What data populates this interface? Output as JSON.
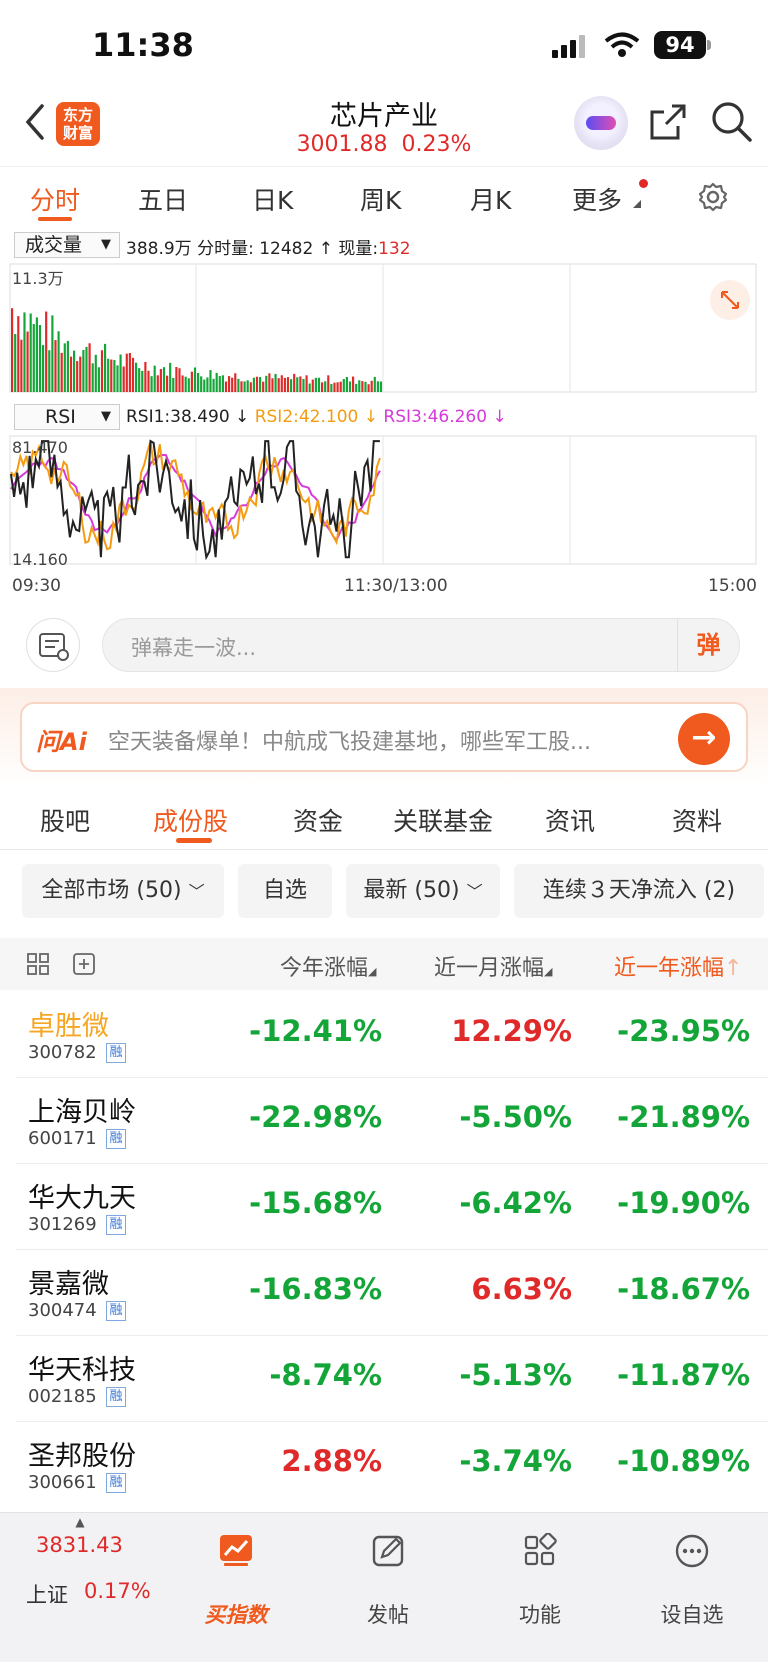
{
  "status_bar": {
    "time": "11:38",
    "battery": "94"
  },
  "header": {
    "brand": "东方\n财富",
    "title": "芯片产业",
    "price": "3001.88",
    "change": "0.23%"
  },
  "tabs": [
    "分时",
    "五日",
    "日K",
    "周K",
    "月K",
    "更多"
  ],
  "volume_panel": {
    "selector": "成交量",
    "total": "388.9万",
    "fenshi_label": "分时量:",
    "fenshi_value": "12482",
    "xianliang_label": "现量:",
    "xianliang_value": "132",
    "ymax": "11.3万"
  },
  "rsi_panel": {
    "selector": "RSI",
    "rsi1": "RSI1:38.490 ↓",
    "rsi2": "RSI2:42.100 ↓",
    "rsi3": "RSI3:46.260 ↓",
    "ymax": "81.470",
    "ymin": "14.160",
    "colors": {
      "rsi1": "#222222",
      "rsi2": "#f39c12",
      "rsi3": "#d63adb"
    }
  },
  "time_axis": {
    "start": "09:30",
    "mid": "11:30/13:00",
    "end": "15:00"
  },
  "danmu": {
    "placeholder": "弹幕走一波...",
    "button": "弹"
  },
  "ai": {
    "logo": "问Ai",
    "text": "空天装备爆单！中航成飞投建基地，哪些军工股..."
  },
  "subtabs": [
    "股吧",
    "成份股",
    "资金",
    "关联基金",
    "资讯",
    "资料"
  ],
  "filters": [
    "全部市场 (50)",
    "自选",
    "最新 (50)",
    "连续３天净流入 (2)"
  ],
  "table": {
    "headers": [
      "今年涨幅",
      "近一月涨幅",
      "近一年涨幅"
    ],
    "rows": [
      {
        "name": "卓胜微",
        "code": "300782",
        "tag": "融",
        "ytd": "-12.41%",
        "m1": "12.29%",
        "y1": "-23.95%"
      },
      {
        "name": "上海贝岭",
        "code": "600171",
        "tag": "融",
        "ytd": "-22.98%",
        "m1": "-5.50%",
        "y1": "-21.89%"
      },
      {
        "name": "华大九天",
        "code": "301269",
        "tag": "融",
        "ytd": "-15.68%",
        "m1": "-6.42%",
        "y1": "-19.90%"
      },
      {
        "name": "景嘉微",
        "code": "300474",
        "tag": "融",
        "ytd": "-16.83%",
        "m1": "6.63%",
        "y1": "-18.67%"
      },
      {
        "name": "华天科技",
        "code": "002185",
        "tag": "融",
        "ytd": "-8.74%",
        "m1": "-5.13%",
        "y1": "-11.87%"
      },
      {
        "name": "圣邦股份",
        "code": "300661",
        "tag": "融",
        "ytd": "2.88%",
        "m1": "-3.74%",
        "y1": "-10.89%"
      }
    ]
  },
  "bottom_bar": {
    "index_value": "3831.43",
    "index_name": "上证",
    "index_change": "0.17%",
    "items": [
      "买指数",
      "发帖",
      "功能",
      "设自选"
    ]
  }
}
